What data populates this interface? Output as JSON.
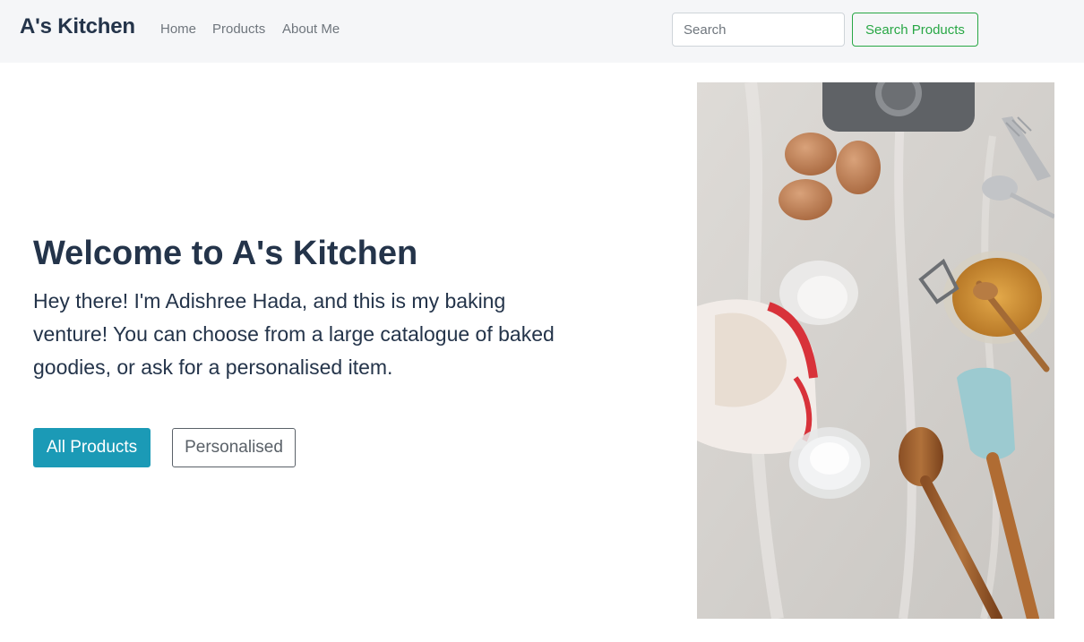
{
  "navbar": {
    "brand": "A's Kitchen",
    "links": [
      "Home",
      "Products",
      "About Me"
    ],
    "search": {
      "placeholder": "Search",
      "button_label": "Search Products"
    }
  },
  "hero": {
    "title": "Welcome to A's Kitchen",
    "text": "Hey there! I'm Adishree Hada, and this is my baking venture! You can choose from a large catalogue of baked goodies, or ask for a personalised item.",
    "buttons": {
      "primary": "All Products",
      "secondary": "Personalised"
    },
    "image_subject": "baking-ingredients-photo"
  },
  "colors": {
    "navbar_bg": "#f5f6f8",
    "text": "#24344a",
    "accent": "#1b9ab6",
    "success": "#28a745"
  }
}
